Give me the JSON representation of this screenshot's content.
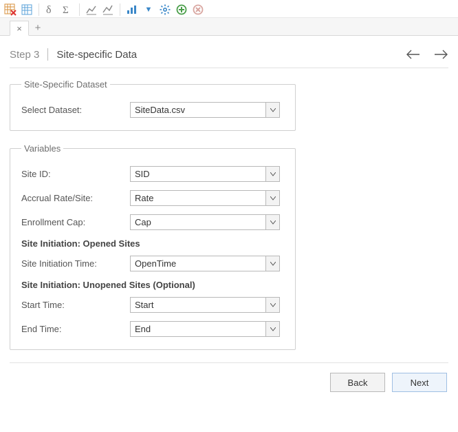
{
  "step": {
    "label": "Step 3",
    "title": "Site-specific Data"
  },
  "groups": {
    "dataset": {
      "legend": "Site-Specific Dataset",
      "select_label": "Select Dataset:",
      "select_value": "SiteData.csv"
    },
    "variables": {
      "legend": "Variables",
      "site_id_label": "Site ID:",
      "site_id_value": "SID",
      "accrual_label": "Accrual Rate/Site:",
      "accrual_value": "Rate",
      "cap_label": "Enrollment Cap:",
      "cap_value": "Cap",
      "opened_heading": "Site Initiation: Opened Sites",
      "init_time_label": "Site Initiation Time:",
      "init_time_value": "OpenTime",
      "unopened_heading": "Site Initiation: Unopened Sites (Optional)",
      "start_label": "Start Time:",
      "start_value": "Start",
      "end_label": "End Time:",
      "end_value": "End"
    }
  },
  "buttons": {
    "back": "Back",
    "next": "Next"
  },
  "tabs": {
    "close_glyph": "×",
    "add_glyph": "+"
  }
}
